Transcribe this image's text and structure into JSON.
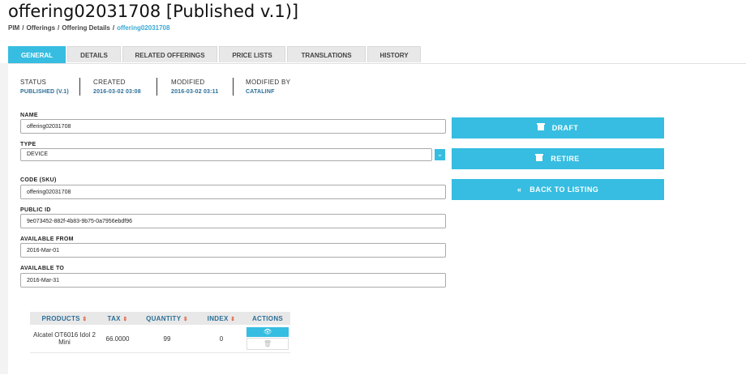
{
  "page": {
    "title": "offering02031708 [Published v.1)]",
    "breadcrumbs": [
      "PIM",
      "Offerings",
      "Offering Details",
      "offering02031708"
    ]
  },
  "tabs": [
    "GENERAL",
    "DETAILS",
    "RELATED OFFERINGS",
    "PRICE LISTS",
    "TRANSLATIONS",
    "HISTORY"
  ],
  "meta": [
    {
      "label": "STATUS",
      "value": "PUBLISHED (V.1)"
    },
    {
      "label": "CREATED",
      "value": "2016-03-02 03:08"
    },
    {
      "label": "MODIFIED",
      "value": "2016-03-02 03:11"
    },
    {
      "label": "MODIFIED BY",
      "value": "CATALINF"
    }
  ],
  "form": {
    "name_label": "NAME",
    "name_value": "offering02031708",
    "type_label": "TYPE",
    "type_value": "DEVICE",
    "code_label": "CODE (SKU)",
    "code_value": "offering02031708",
    "public_id_label": "PUBLIC ID",
    "public_id_value": "9e073452-882f-4b83-9b75-0a7956ebdf96",
    "available_from_label": "AVAILABLE FROM",
    "available_from_value": "2016-Mar-01",
    "available_to_label": "AVAILABLE TO",
    "available_to_value": "2016-Mar-31"
  },
  "actions": {
    "draft": "DRAFT",
    "retire": "RETIRE",
    "back": "BACK TO LISTING"
  },
  "table": {
    "headers": [
      "PRODUCTS",
      "TAX",
      "QUANTITY",
      "INDEX",
      "ACTIONS"
    ],
    "rows": [
      {
        "product": "Alcatel OT6016 Idol 2 Mini",
        "tax": "66.0000",
        "quantity": "99",
        "index": "0"
      }
    ]
  },
  "colors": {
    "accent": "#36bde1",
    "link": "#2a6e96",
    "sort": "#e05a3a"
  },
  "icons": [
    "archive-icon",
    "double-chevron-left-icon",
    "eye-icon",
    "trash-icon",
    "chevron-down-icon",
    "sort-icon"
  ]
}
